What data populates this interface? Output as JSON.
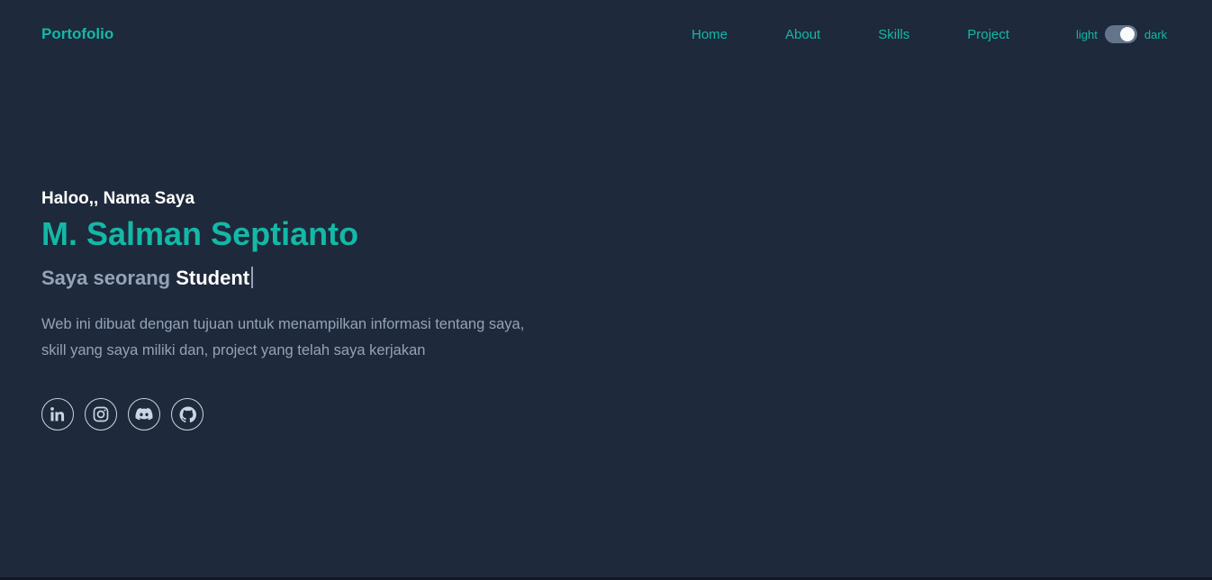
{
  "header": {
    "brand": "Portofolio",
    "nav": [
      "Home",
      "About",
      "Skills",
      "Project"
    ],
    "theme": {
      "light_label": "light",
      "dark_label": "dark",
      "is_dark": true
    }
  },
  "hero": {
    "greeting": "Haloo,, Nama Saya",
    "name": "M. Salman Septianto",
    "role_prefix": "Saya seorang",
    "role_word": "Student",
    "description_line1": "Web ini dibuat dengan tujuan untuk menampilkan informasi tentang saya,",
    "description_line2": "skill yang saya miliki dan, project yang telah saya kerjakan"
  },
  "socials": [
    {
      "icon": "linkedin-icon"
    },
    {
      "icon": "instagram-icon"
    },
    {
      "icon": "discord-icon"
    },
    {
      "icon": "github-icon"
    }
  ],
  "colors": {
    "background": "#1e293b",
    "accent": "#14b8a6",
    "muted": "#94a3b8",
    "heading": "#ffffff"
  }
}
